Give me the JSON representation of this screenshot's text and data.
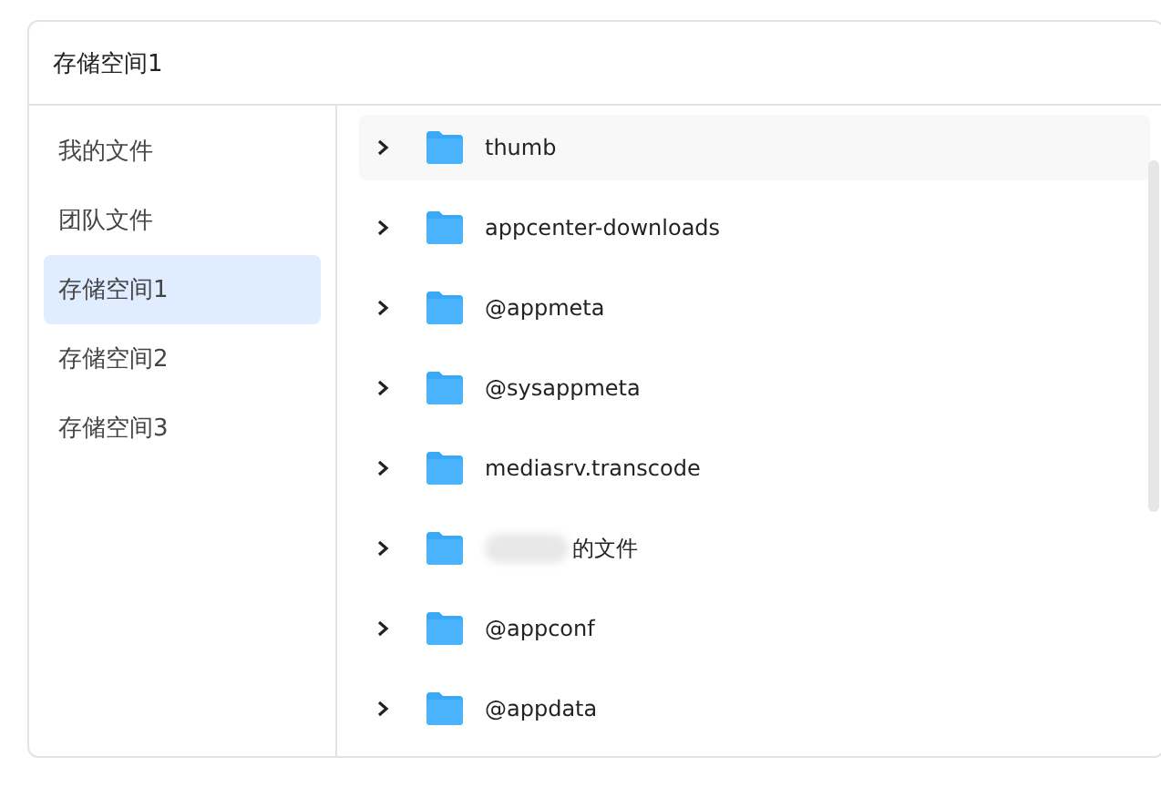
{
  "window": {
    "title": "存储空间1"
  },
  "sidebar": {
    "items": [
      {
        "label": "我的文件",
        "selected": false
      },
      {
        "label": "团队文件",
        "selected": false
      },
      {
        "label": "存储空间1",
        "selected": true
      },
      {
        "label": "存储空间2",
        "selected": false
      },
      {
        "label": "存储空间3",
        "selected": false
      }
    ]
  },
  "folders": [
    {
      "name": "thumb",
      "hovered": true,
      "redacted": false
    },
    {
      "name": "appcenter-downloads",
      "hovered": false,
      "redacted": false
    },
    {
      "name": "@appmeta",
      "hovered": false,
      "redacted": false
    },
    {
      "name": "@sysappmeta",
      "hovered": false,
      "redacted": false
    },
    {
      "name": "mediasrv.transcode",
      "hovered": false,
      "redacted": false
    },
    {
      "name": "的文件",
      "hovered": false,
      "redacted": true
    },
    {
      "name": "@appconf",
      "hovered": false,
      "redacted": false
    },
    {
      "name": "@appdata",
      "hovered": false,
      "redacted": false
    }
  ]
}
